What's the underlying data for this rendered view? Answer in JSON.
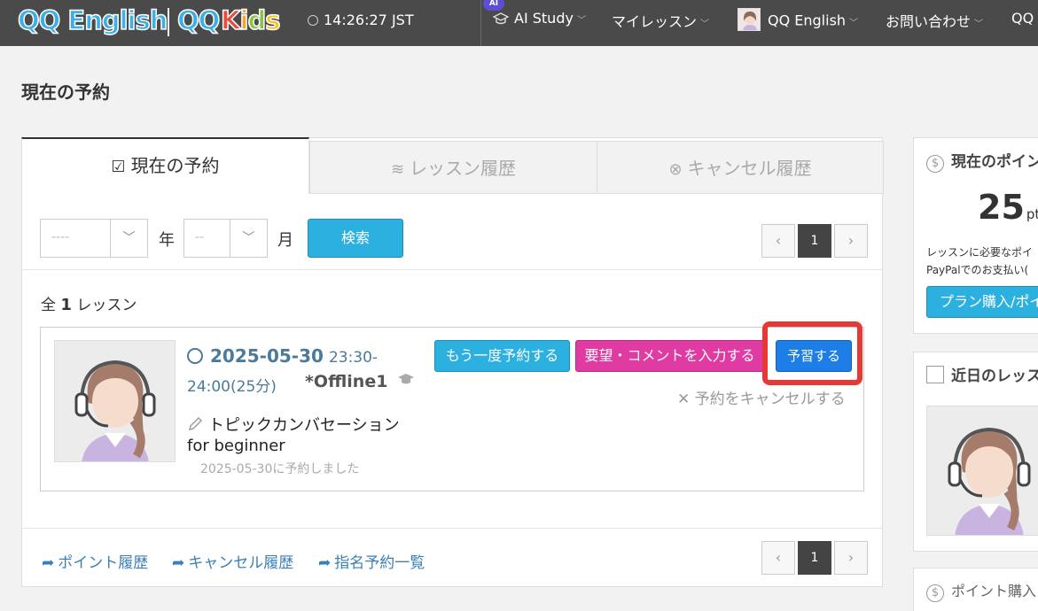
{
  "header": {
    "logo_qq_english": "QQ English",
    "logo_qq": "QQ",
    "logo_kids": [
      "K",
      "i",
      "d",
      "s"
    ],
    "clock": "14:26:27 JST",
    "ai_badge": "AI",
    "nav": {
      "ai_study": "AI Study",
      "my_lessons": "マイレッスン",
      "account": "QQ English",
      "contact": "お問い合わせ",
      "more": "QQ"
    }
  },
  "page": {
    "title": "現在の予約"
  },
  "tabs": {
    "current": "現在の予約",
    "history": "レッスン履歴",
    "cancel_history": "キャンセル履歴"
  },
  "filter": {
    "year_value": "----",
    "year_unit": "年",
    "month_value": "--",
    "month_unit": "月",
    "search_label": "検索"
  },
  "pagination": {
    "prev": "‹",
    "current": "1",
    "next": "›"
  },
  "summary": {
    "prefix": "全",
    "count": "1",
    "suffix": "レッスン"
  },
  "lesson": {
    "date": "2025-05-30",
    "time_start": "23:30-",
    "time_end": "24:00(25分)",
    "teacher": "*Offline1",
    "topic_line1": "トピックカンバセーション",
    "topic_line2": "for beginner",
    "booked_on": "2025-05-30に予約しました",
    "rebook_label": "もう一度予約する",
    "comment_label": "要望・コメントを入力する",
    "prepare_label": "予習する",
    "cancel_label": "予約をキャンセルする"
  },
  "footer_links": {
    "points_history": "ポイント履歴",
    "cancel_history": "キャンセル履歴",
    "nominated": "指名予約一覧"
  },
  "sidebar": {
    "points_title": "現在のポイン",
    "points_value": "25",
    "points_unit": "pts",
    "points_note1": "レッスンに必要なポイ",
    "points_note2": "PayPalでのお支払い(",
    "buy_button": "プラン購入/ポイ",
    "upcoming_title": "近日のレッス",
    "points_buy_title": "ポイント購入"
  },
  "colors": {
    "topbar": "#4a4a4a",
    "primary_button": "#2bb0e0",
    "comment_button": "#e03aa3",
    "prepare_button": "#1e7ee8",
    "highlight": "#e53935",
    "date_text": "#4a7a9c",
    "link": "#3a7fb5"
  }
}
